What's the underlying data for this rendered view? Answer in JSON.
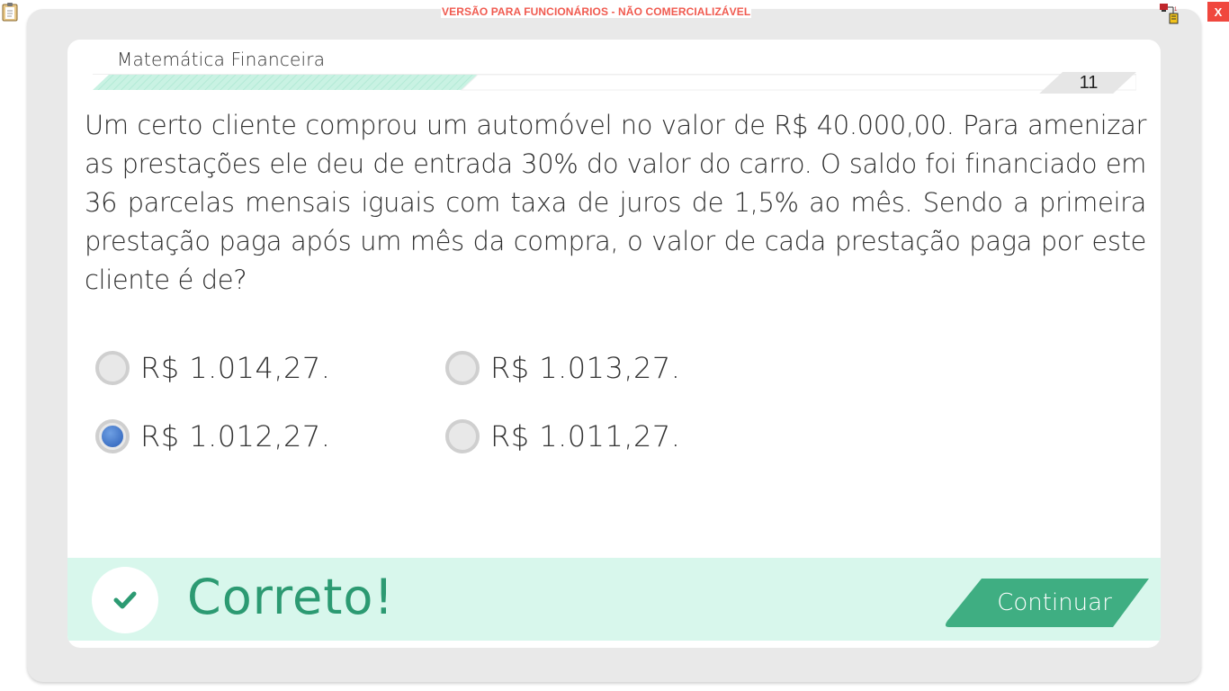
{
  "chrome": {
    "watermark": "VERSÃO PARA FUNCIONÁRIOS - NÃO COMERCIALIZÁVEL",
    "close_label": "X",
    "icons": [
      "clipboard-icon",
      "network-icon"
    ]
  },
  "header": {
    "subject": "Matemática Financeira",
    "question_number": "11"
  },
  "question": {
    "text": "Um certo cliente comprou um automóvel no valor de R$ 40.000,00. Para amenizar as prestações ele deu de entrada 30% do valor do carro. O saldo foi financiado em 36 parcelas mensais iguais com taxa de juros de 1,5% ao mês. Sendo a primeira prestação paga após um mês da compra, o valor de cada prestação paga por este cliente é de?"
  },
  "options": [
    {
      "label": "R$ 1.014,27.",
      "selected": false
    },
    {
      "label": "R$ 1.013,27.",
      "selected": false
    },
    {
      "label": "R$ 1.012,27.",
      "selected": true
    },
    {
      "label": "R$ 1.011,27.",
      "selected": false
    }
  ],
  "feedback": {
    "text": "Correto!",
    "continue_label": "Continuar",
    "colors": {
      "bar_background": "#d8f7ec",
      "accent": "#2c9a72",
      "button": "#3fae82"
    }
  },
  "colors": {
    "frame": "#e9e9e9",
    "watermark": "#f05a4f",
    "close": "#f0473e",
    "radio_selected": "#2b5fb8"
  }
}
